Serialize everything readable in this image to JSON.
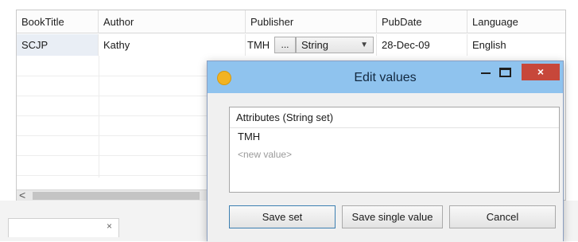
{
  "grid": {
    "columns": [
      "BookTitle",
      "Author",
      "Publisher",
      "PubDate",
      "Language"
    ],
    "rows": [
      {
        "BookTitle": "SCJP",
        "Author": "Kathy",
        "Publisher": "TMH",
        "PubDate": "28-Dec-09",
        "Language": "English"
      }
    ],
    "publisher_editor": {
      "ellipsis_label": "...",
      "type_selected": "String"
    }
  },
  "scrollbar": {
    "left_arrow": "<"
  },
  "dialog": {
    "title": "Edit values",
    "close_label": "×",
    "list_header": "Attributes (String set)",
    "values": [
      "TMH"
    ],
    "new_value_placeholder": "<new value>",
    "buttons": {
      "save_set": "Save set",
      "save_single": "Save single value",
      "cancel": "Cancel"
    }
  },
  "colors": {
    "title_bar": "#8fc3ee",
    "close_button": "#c7473a",
    "selected_cell": "#e9eef5"
  },
  "icons": {
    "app": "app-icon",
    "minimize": "minimize-icon",
    "maximize": "maximize-icon",
    "close": "close-icon",
    "dropdown": "chevron-down-icon",
    "scroll_left": "chevron-left-icon"
  }
}
